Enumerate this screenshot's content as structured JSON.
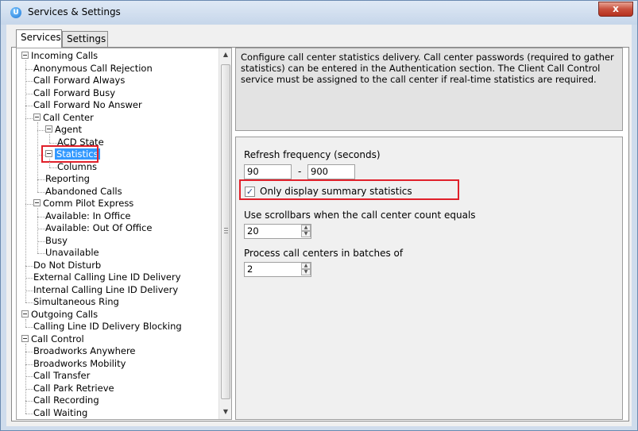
{
  "window": {
    "title": "Services & Settings",
    "close_label": "x"
  },
  "tabs": [
    {
      "label": "Services",
      "active": true
    },
    {
      "label": "Settings",
      "active": false
    }
  ],
  "tree": [
    {
      "label": "Incoming Calls",
      "level": 0,
      "expandable": true
    },
    {
      "label": "Anonymous Call Rejection",
      "level": 1
    },
    {
      "label": "Call Forward Always",
      "level": 1
    },
    {
      "label": "Call Forward Busy",
      "level": 1
    },
    {
      "label": "Call Forward No Answer",
      "level": 1
    },
    {
      "label": "Call Center",
      "level": 1,
      "expandable": true
    },
    {
      "label": "Agent",
      "level": 2,
      "expandable": true
    },
    {
      "label": "ACD State",
      "level": 3
    },
    {
      "label": "Statistics",
      "level": 2,
      "expandable": true,
      "selected": true
    },
    {
      "label": "Columns",
      "level": 3
    },
    {
      "label": "Reporting",
      "level": 2
    },
    {
      "label": "Abandoned Calls",
      "level": 2
    },
    {
      "label": "Comm Pilot Express",
      "level": 1,
      "expandable": true
    },
    {
      "label": "Available: In Office",
      "level": 2
    },
    {
      "label": "Available: Out Of Office",
      "level": 2
    },
    {
      "label": "Busy",
      "level": 2
    },
    {
      "label": "Unavailable",
      "level": 2
    },
    {
      "label": "Do Not Disturb",
      "level": 1
    },
    {
      "label": "External Calling Line ID Delivery",
      "level": 1
    },
    {
      "label": "Internal Calling Line ID Delivery",
      "level": 1
    },
    {
      "label": "Simultaneous Ring",
      "level": 1
    },
    {
      "label": "Outgoing Calls",
      "level": 0,
      "expandable": true
    },
    {
      "label": "Calling Line ID Delivery Blocking",
      "level": 1
    },
    {
      "label": "Call Control",
      "level": 0,
      "expandable": true
    },
    {
      "label": "Broadworks Anywhere",
      "level": 1
    },
    {
      "label": "Broadworks Mobility",
      "level": 1
    },
    {
      "label": "Call Transfer",
      "level": 1
    },
    {
      "label": "Call Park Retrieve",
      "level": 1
    },
    {
      "label": "Call Recording",
      "level": 1
    },
    {
      "label": "Call Waiting",
      "level": 1
    }
  ],
  "description": "Configure call center statistics delivery.  Call center passwords (required to gather statistics) can be entered in the Authentication section.  The Client Call Control service must be assigned to the call center if real-time statistics are required.",
  "settings": {
    "refresh_label": "Refresh frequency (seconds)",
    "refresh_min": "90",
    "refresh_separator": "-",
    "refresh_max": "900",
    "summary_label": "Only display summary statistics",
    "summary_checked": true,
    "scrollbars_label": "Use scrollbars when the call center count equals",
    "scrollbars_value": "20",
    "batches_label": "Process call centers in batches of",
    "batches_value": "2"
  }
}
